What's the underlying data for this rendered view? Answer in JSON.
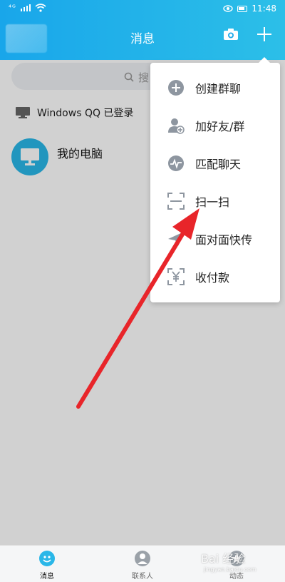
{
  "status_bar": {
    "signal": "⁴ᴳ",
    "time": "11:48"
  },
  "header": {
    "title": "消息"
  },
  "search": {
    "placeholder": "搜"
  },
  "login_banner": {
    "text": "Windows QQ 已登录"
  },
  "conversations": [
    {
      "name": "我的电脑"
    }
  ],
  "menu": {
    "items": [
      {
        "label": "创建群聊",
        "icon": "plus-circle-icon"
      },
      {
        "label": "加好友/群",
        "icon": "add-friend-icon"
      },
      {
        "label": "匹配聊天",
        "icon": "match-chat-icon"
      },
      {
        "label": "扫一扫",
        "icon": "scan-icon"
      },
      {
        "label": "面对面快传",
        "icon": "send-plane-icon"
      },
      {
        "label": "收付款",
        "icon": "yuan-icon"
      }
    ]
  },
  "bottom_nav": {
    "tabs": [
      {
        "label": "消息",
        "icon": "qq-penguin-icon"
      },
      {
        "label": "联系人",
        "icon": "contacts-icon"
      },
      {
        "label": "动态",
        "icon": "star-icon"
      }
    ]
  },
  "watermark": {
    "text": "Bai 经验",
    "sub": "jingyan.baidu.com"
  },
  "colors": {
    "header": "#1ea9ea",
    "accent": "#2ab7e8",
    "arrow": "#e8252a",
    "icon_gray": "#8e96a0"
  }
}
